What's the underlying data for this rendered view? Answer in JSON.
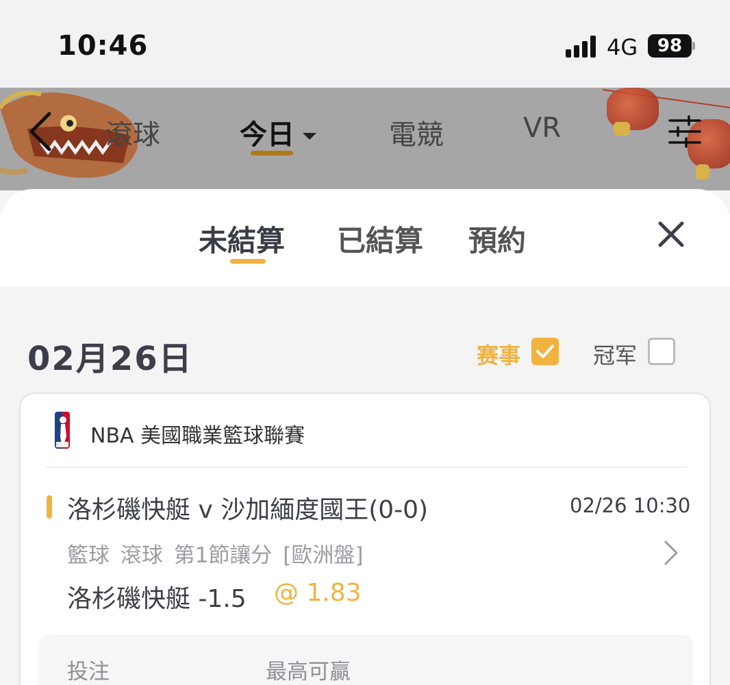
{
  "status_bar": {
    "time": "10:46",
    "network": "4G",
    "battery": "98"
  },
  "top_nav": {
    "tabs": [
      {
        "label": "滾球"
      },
      {
        "label": "今日",
        "active": true
      },
      {
        "label": "電競"
      },
      {
        "label": "VR"
      }
    ],
    "back_icon": "chevron-left-icon",
    "filter_icon": "sliders-icon"
  },
  "sheet": {
    "tabs": [
      {
        "label": "未結算",
        "active": true
      },
      {
        "label": "已結算"
      },
      {
        "label": "預約"
      }
    ],
    "close_icon": "close-icon"
  },
  "date_header": "02月26日",
  "filters": {
    "events_label": "赛事",
    "events_checked": true,
    "champion_label": "冠军",
    "champion_checked": false
  },
  "bet": {
    "league": "NBA 美國職業籃球聯賽",
    "match": "洛杉磯快艇 v 沙加緬度國王(0-0)",
    "match_time": "02/26 10:30",
    "details": "籃球 滾球 第1節讓分 [歐洲盤]",
    "pick": "洛杉磯快艇 -1.5",
    "odds": "@ 1.83",
    "stake_label": "投注",
    "max_win_label": "最高可贏"
  },
  "colors": {
    "accent": "#f2b23e",
    "nav_underline": "#b07a1a",
    "text_primary": "#3c3f4a",
    "text_secondary": "#9a9ca3"
  }
}
